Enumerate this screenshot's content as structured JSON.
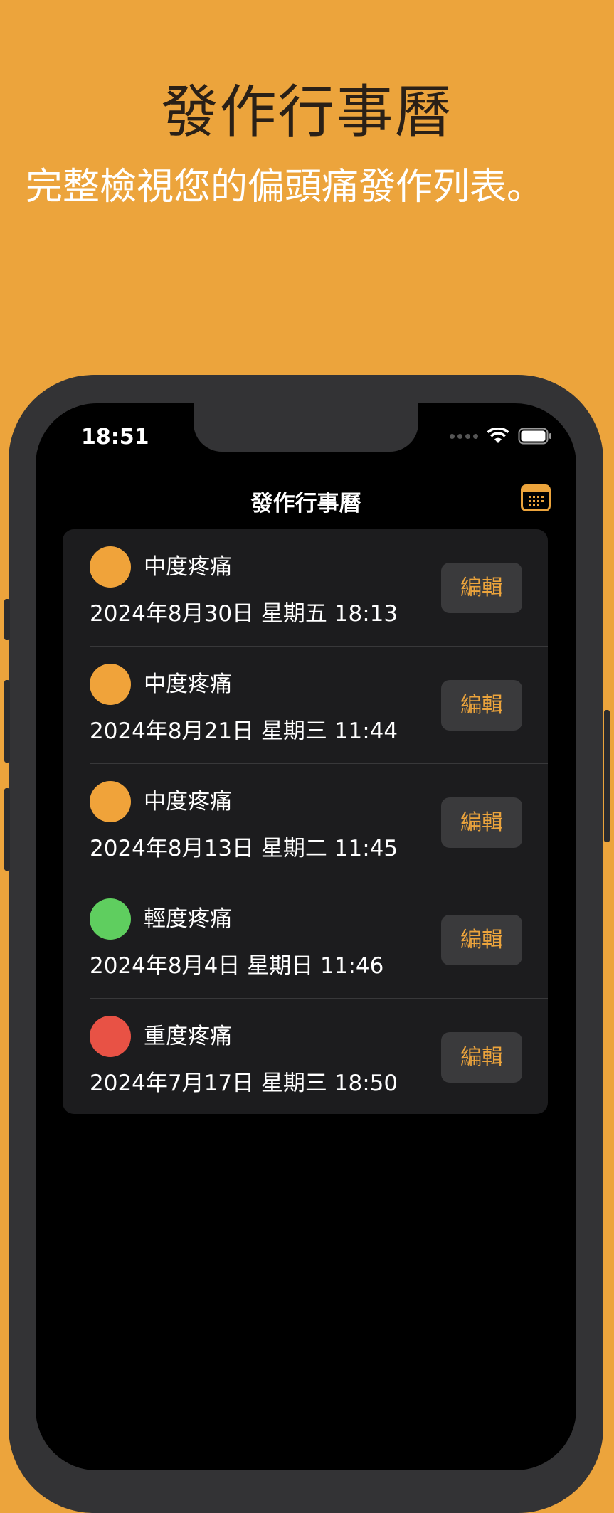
{
  "promo": {
    "title": "發作行事曆",
    "subtitle": "完整檢視您的偏頭痛發作列表。"
  },
  "status_bar": {
    "time": "18:51"
  },
  "nav": {
    "title": "發作行事曆",
    "calendar_icon": "calendar-icon"
  },
  "colors": {
    "background": "#eca43c",
    "moderate": "#f0a33a",
    "mild": "#5fce5f",
    "severe": "#e85245",
    "accent": "#eca43c"
  },
  "episodes": [
    {
      "severity": "中度疼痛",
      "datetime": "2024年8月30日 星期五 18:13",
      "edit_label": "編輯",
      "color": "#f0a33a"
    },
    {
      "severity": "中度疼痛",
      "datetime": "2024年8月21日 星期三 11:44",
      "edit_label": "編輯",
      "color": "#f0a33a"
    },
    {
      "severity": "中度疼痛",
      "datetime": "2024年8月13日 星期二 11:45",
      "edit_label": "編輯",
      "color": "#f0a33a"
    },
    {
      "severity": "輕度疼痛",
      "datetime": "2024年8月4日 星期日 11:46",
      "edit_label": "編輯",
      "color": "#5fce5f"
    },
    {
      "severity": "重度疼痛",
      "datetime": "2024年7月17日 星期三 18:50",
      "edit_label": "編輯",
      "color": "#e85245"
    }
  ]
}
